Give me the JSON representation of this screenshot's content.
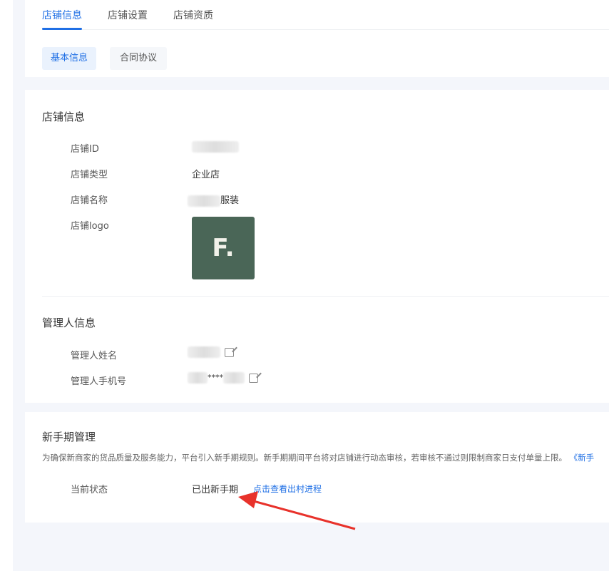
{
  "tabs": [
    "店铺信息",
    "店铺设置",
    "店铺资质"
  ],
  "subtabs": [
    "基本信息",
    "合同协议"
  ],
  "store": {
    "title": "店铺信息",
    "id_label": "店铺ID",
    "type_label": "店铺类型",
    "type_value": "企业店",
    "name_label": "店铺名称",
    "name_value": "服装",
    "logo_label": "店铺logo",
    "logo_text": "F."
  },
  "manager": {
    "title": "管理人信息",
    "name_label": "管理人姓名",
    "phone_label": "管理人手机号",
    "phone_value": "****"
  },
  "newbie": {
    "title": "新手期管理",
    "desc": "为确保新商家的货品质量及服务能力，平台引入新手期规则。新手期期间平台将对店铺进行动态审核，若审核不通过则限制商家日支付单量上限。",
    "desc_link": "《新手",
    "status_label": "当前状态",
    "status_value": "已出新手期",
    "progress_link": "点击查看出村进程"
  },
  "colors": {
    "accent": "#1f6fe5",
    "arrow": "#e8322b"
  }
}
